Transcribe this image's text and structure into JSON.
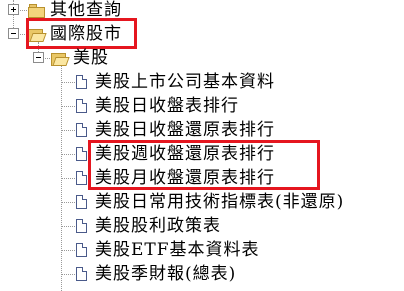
{
  "tree": {
    "other_query": {
      "label": "其他查詢",
      "expander": "+"
    },
    "intl_stock": {
      "label": "國際股市",
      "expander": "-"
    },
    "us_stock": {
      "label": "美股",
      "expander": "-"
    },
    "items": [
      {
        "label": "美股上市公司基本資料"
      },
      {
        "label": "美股日收盤表排行"
      },
      {
        "label": "美股日收盤還原表排行"
      },
      {
        "label": "美股週收盤還原表排行"
      },
      {
        "label": "美股月收盤還原表排行"
      },
      {
        "label": "美股日常用技術指標表(非還原)"
      },
      {
        "label": "美股股利政策表"
      },
      {
        "label": "美股ETF基本資料表"
      },
      {
        "label": "美股季財報(總表)"
      }
    ]
  },
  "colors": {
    "highlight_border": "#e5161f",
    "tree_line": "#9a9a9a"
  },
  "icons": {
    "folder_closed": "folder-icon",
    "folder_open": "open-folder-icon",
    "document": "document-icon"
  }
}
